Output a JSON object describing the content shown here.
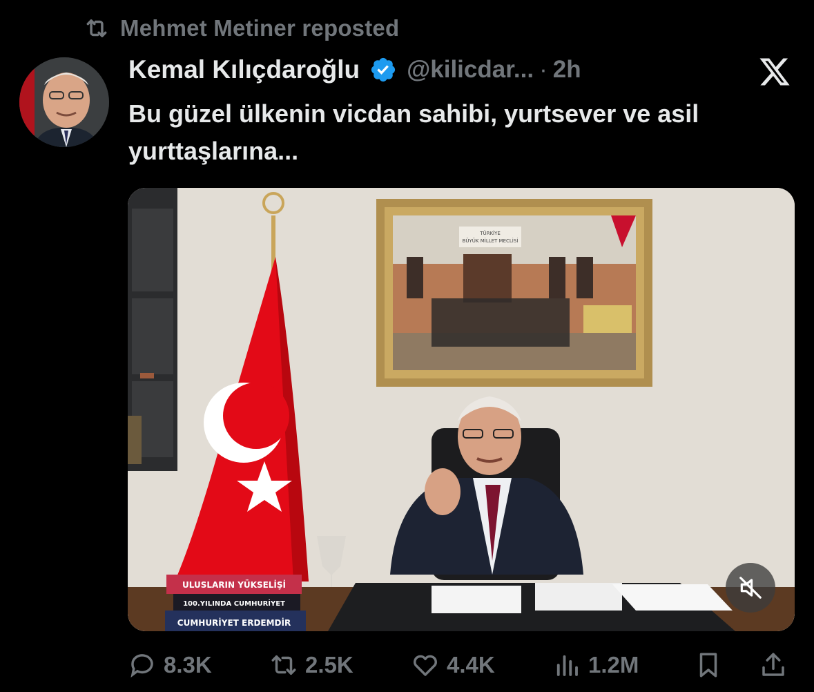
{
  "repost": {
    "label": "Mehmet Metiner reposted",
    "icon": "repost-icon"
  },
  "author": {
    "name": "Kemal Kılıçdaroğlu",
    "handle": "@kilicdar...",
    "separator": "·",
    "time": "2h",
    "verified": true
  },
  "tweet": {
    "text": "Bu güzel ülkenin vicdan sahibi, yurtsever ve asil yurttaşlarına..."
  },
  "media": {
    "type": "video",
    "muted": true,
    "painting_caption": "TÜRKİYE BÜYÜK MİLLET MECLİSİ",
    "book_titles": [
      "ULUSLARIN YÜKSELİŞİ",
      "100.YILINDA CUMHURİYET",
      "CUMHURİYET ERDEMDİR"
    ]
  },
  "actions": {
    "replies": "8.3K",
    "reposts": "2.5K",
    "likes": "4.4K",
    "views": "1.2M"
  },
  "colors": {
    "background": "#000000",
    "text": "#e7e9ea",
    "secondary": "#71767b",
    "verified": "#1d9bf0",
    "flag_red": "#e30a17"
  }
}
